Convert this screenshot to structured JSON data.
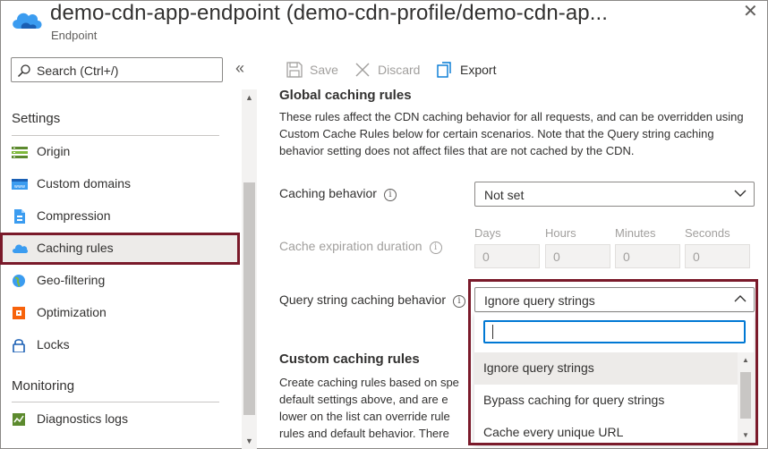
{
  "header": {
    "title": "demo-cdn-app-endpoint (demo-cdn-profile/demo-cdn-ap...",
    "subtitle": "Endpoint",
    "close_glyph": "✕",
    "icon": "cdn-cloud-icon"
  },
  "sidebar": {
    "search_placeholder": "Search (Ctrl+/)",
    "collapse_glyph": "«",
    "sections": [
      {
        "title": "Settings"
      },
      {
        "title": "Monitoring"
      }
    ],
    "items": [
      {
        "label": "Origin",
        "icon": "origin-icon"
      },
      {
        "label": "Custom domains",
        "icon": "custom-domains-icon"
      },
      {
        "label": "Compression",
        "icon": "compression-icon"
      },
      {
        "label": "Caching rules",
        "icon": "caching-rules-icon",
        "active": true
      },
      {
        "label": "Geo-filtering",
        "icon": "geo-filtering-icon"
      },
      {
        "label": "Optimization",
        "icon": "optimization-icon"
      },
      {
        "label": "Locks",
        "icon": "lock-icon"
      },
      {
        "label": "Diagnostics logs",
        "icon": "diagnostics-logs-icon"
      }
    ]
  },
  "toolbar": {
    "save_label": "Save",
    "discard_label": "Discard",
    "export_label": "Export"
  },
  "main": {
    "global_title": "Global caching rules",
    "global_desc_1": "These rules affect the CDN caching behavior for all requests, and can be overridden using",
    "global_desc_2": "Custom Cache Rules below for certain scenarios. Note that the Query string caching",
    "global_desc_3": "behavior setting does not affect files that are not cached by the CDN.",
    "caching_behavior_label": "Caching behavior",
    "caching_behavior_value": "Not set",
    "cache_expiration_label": "Cache expiration duration",
    "duration": [
      {
        "label": "Days",
        "value": "0"
      },
      {
        "label": "Hours",
        "value": "0"
      },
      {
        "label": "Minutes",
        "value": "0"
      },
      {
        "label": "Seconds",
        "value": "0"
      }
    ],
    "query_string_label": "Query string caching behavior",
    "query_string_value": "Ignore query strings",
    "custom_title": "Custom caching rules",
    "custom_desc_1": "Create caching rules based on spe",
    "custom_desc_2": "default settings above, and are e",
    "custom_desc_3": "lower on the list can override rule",
    "custom_desc_4": "rules and default behavior. There"
  },
  "dropdown": {
    "search_value": "",
    "options": [
      {
        "label": "Ignore query strings",
        "selected": true
      },
      {
        "label": "Bypass caching for query strings",
        "selected": false
      },
      {
        "label": "Cache every unique URL",
        "selected": false
      }
    ]
  },
  "colors": {
    "highlight_border": "#7a1a2a",
    "accent": "#0078d4"
  }
}
